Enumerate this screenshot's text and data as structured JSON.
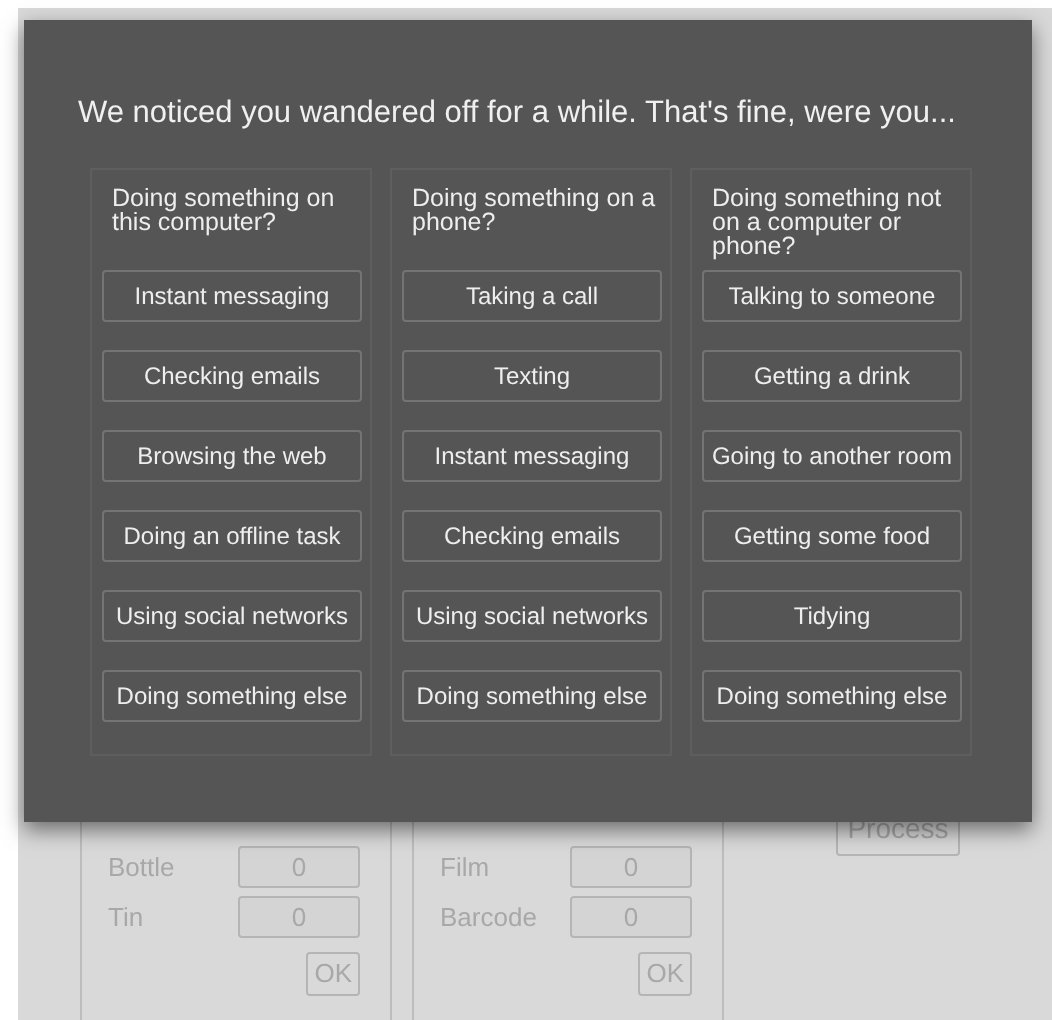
{
  "dialog": {
    "title": "We noticed you wandered off for a while. That's fine, were you...",
    "columns": [
      {
        "heading": "Doing something on this computer?",
        "options": [
          "Instant messaging",
          "Checking emails",
          "Browsing the web",
          "Doing an offline task",
          "Using social networks",
          "Doing something else"
        ]
      },
      {
        "heading": "Doing something on a phone?",
        "options": [
          "Taking a call",
          "Texting",
          "Instant messaging",
          "Checking emails",
          "Using social networks",
          "Doing something else"
        ]
      },
      {
        "heading": "Doing something not on a computer or phone?",
        "options": [
          "Talking to someone",
          "Getting a drink",
          "Going to another room",
          "Getting some food",
          "Tidying",
          "Doing something else"
        ]
      }
    ]
  },
  "background": {
    "panels": [
      {
        "fields": [
          {
            "label": "Bottle",
            "value": "0"
          },
          {
            "label": "Tin",
            "value": "0"
          }
        ],
        "button": "OK"
      },
      {
        "fields": [
          {
            "label": "Film",
            "value": "0"
          },
          {
            "label": "Barcode",
            "value": "0"
          }
        ],
        "button": "OK"
      }
    ],
    "process_button": "Process"
  }
}
